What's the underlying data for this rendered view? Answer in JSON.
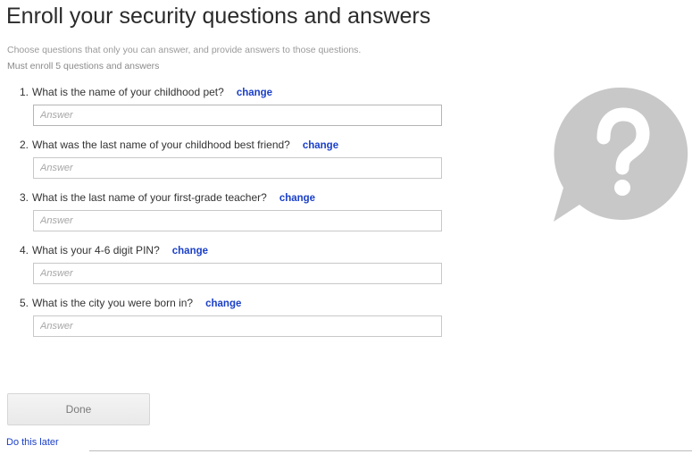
{
  "header": {
    "title": "Enroll your security questions and answers",
    "subtitle": "Choose questions that only you can answer, and provide answers to those questions.",
    "requirement": "Must enroll 5 questions and answers"
  },
  "questions": [
    {
      "number": "1.",
      "text": "What is the name of your childhood pet?",
      "change_label": "change",
      "answer_placeholder": "Answer",
      "answer_value": ""
    },
    {
      "number": "2.",
      "text": "What was the last name of your childhood best friend?",
      "change_label": "change",
      "answer_placeholder": "Answer",
      "answer_value": ""
    },
    {
      "number": "3.",
      "text": "What is the last name of your first-grade teacher?",
      "change_label": "change",
      "answer_placeholder": "Answer",
      "answer_value": ""
    },
    {
      "number": "4.",
      "text": "What is your 4-6 digit PIN?",
      "change_label": "change",
      "answer_placeholder": "Answer",
      "answer_value": ""
    },
    {
      "number": "5.",
      "text": "What is the city you were born in?",
      "change_label": "change",
      "answer_placeholder": "Answer",
      "answer_value": ""
    }
  ],
  "help_graphic": {
    "icon": "question-speech-bubble-icon",
    "glyph": "?",
    "color": "#c8c8c8"
  },
  "actions": {
    "done_label": "Done",
    "later_label": "Do this later"
  }
}
